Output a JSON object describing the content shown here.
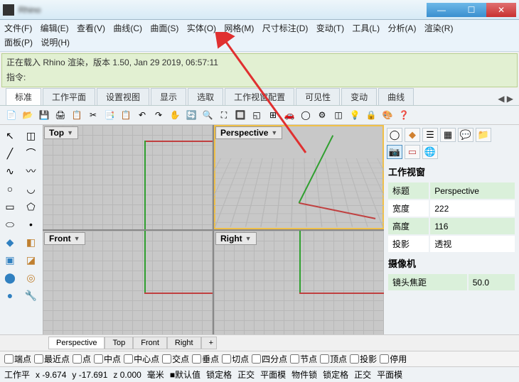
{
  "title": "Rhino",
  "menu": [
    "文件(F)",
    "编辑(E)",
    "查看(V)",
    "曲线(C)",
    "曲面(S)",
    "实体(O)",
    "网格(M)",
    "尺寸标注(D)",
    "变动(T)",
    "工具(L)",
    "分析(A)",
    "渲染(R)",
    "面板(P)",
    "说明(H)"
  ],
  "console": {
    "message": "正在载入 Rhino 渲染，版本 1.50, Jan 29 2019, 06:57:11",
    "prompt": "指令:"
  },
  "tabs": [
    "标准",
    "工作平面",
    "设置视图",
    "显示",
    "选取",
    "工作视窗配置",
    "可见性",
    "变动",
    "曲线"
  ],
  "tabs_active": 0,
  "viewports": {
    "top_left": "Top",
    "top_right": "Perspective",
    "bottom_left": "Front",
    "bottom_right": "Right",
    "active": "top_right"
  },
  "right_panel": {
    "section1_title": "工作视窗",
    "props": [
      {
        "label": "标题",
        "value": "Perspective"
      },
      {
        "label": "宽度",
        "value": "222"
      },
      {
        "label": "高度",
        "value": "116"
      },
      {
        "label": "投影",
        "value": "透视"
      }
    ],
    "section2_title": "摄像机",
    "props2": [
      {
        "label": "镜头焦距",
        "value": "50.0"
      }
    ]
  },
  "view_tabs": [
    "Perspective",
    "Top",
    "Front",
    "Right"
  ],
  "osnaps": [
    "端点",
    "最近点",
    "点",
    "中点",
    "中心点",
    "交点",
    "垂点",
    "切点",
    "四分点",
    "节点",
    "顶点",
    "投影",
    "停用"
  ],
  "status": {
    "cplane": "工作平",
    "x": "x -9.674",
    "y": "y -17.691",
    "z": "z 0.000",
    "unit": "毫米",
    "layer": "■默认值",
    "items": [
      "锁定格",
      "正交",
      "平面模",
      "物件锁",
      "锁定格",
      "正交",
      "平面模"
    ]
  }
}
